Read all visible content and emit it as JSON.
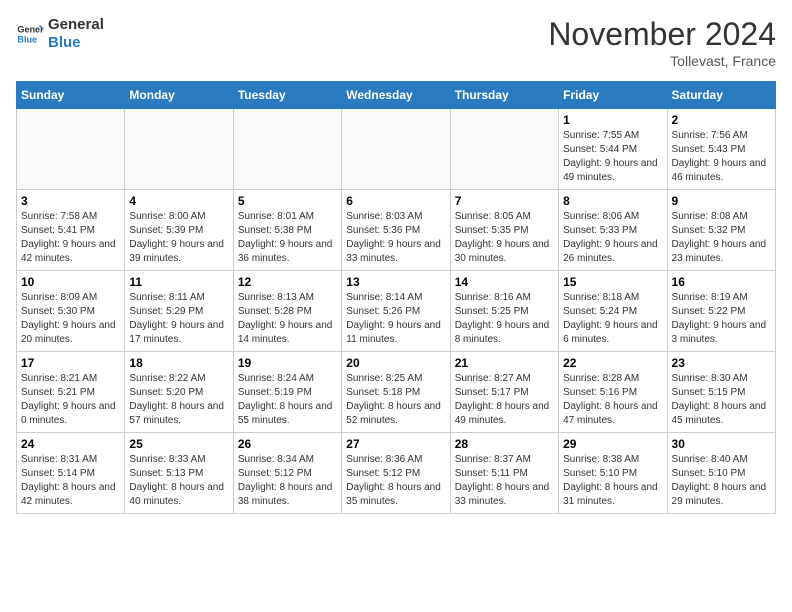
{
  "logo": {
    "line1": "General",
    "line2": "Blue"
  },
  "title": "November 2024",
  "location": "Tollevast, France",
  "weekdays": [
    "Sunday",
    "Monday",
    "Tuesday",
    "Wednesday",
    "Thursday",
    "Friday",
    "Saturday"
  ],
  "weeks": [
    [
      {
        "day": "",
        "info": ""
      },
      {
        "day": "",
        "info": ""
      },
      {
        "day": "",
        "info": ""
      },
      {
        "day": "",
        "info": ""
      },
      {
        "day": "",
        "info": ""
      },
      {
        "day": "1",
        "info": "Sunrise: 7:55 AM\nSunset: 5:44 PM\nDaylight: 9 hours and 49 minutes."
      },
      {
        "day": "2",
        "info": "Sunrise: 7:56 AM\nSunset: 5:43 PM\nDaylight: 9 hours and 46 minutes."
      }
    ],
    [
      {
        "day": "3",
        "info": "Sunrise: 7:58 AM\nSunset: 5:41 PM\nDaylight: 9 hours and 42 minutes."
      },
      {
        "day": "4",
        "info": "Sunrise: 8:00 AM\nSunset: 5:39 PM\nDaylight: 9 hours and 39 minutes."
      },
      {
        "day": "5",
        "info": "Sunrise: 8:01 AM\nSunset: 5:38 PM\nDaylight: 9 hours and 36 minutes."
      },
      {
        "day": "6",
        "info": "Sunrise: 8:03 AM\nSunset: 5:36 PM\nDaylight: 9 hours and 33 minutes."
      },
      {
        "day": "7",
        "info": "Sunrise: 8:05 AM\nSunset: 5:35 PM\nDaylight: 9 hours and 30 minutes."
      },
      {
        "day": "8",
        "info": "Sunrise: 8:06 AM\nSunset: 5:33 PM\nDaylight: 9 hours and 26 minutes."
      },
      {
        "day": "9",
        "info": "Sunrise: 8:08 AM\nSunset: 5:32 PM\nDaylight: 9 hours and 23 minutes."
      }
    ],
    [
      {
        "day": "10",
        "info": "Sunrise: 8:09 AM\nSunset: 5:30 PM\nDaylight: 9 hours and 20 minutes."
      },
      {
        "day": "11",
        "info": "Sunrise: 8:11 AM\nSunset: 5:29 PM\nDaylight: 9 hours and 17 minutes."
      },
      {
        "day": "12",
        "info": "Sunrise: 8:13 AM\nSunset: 5:28 PM\nDaylight: 9 hours and 14 minutes."
      },
      {
        "day": "13",
        "info": "Sunrise: 8:14 AM\nSunset: 5:26 PM\nDaylight: 9 hours and 11 minutes."
      },
      {
        "day": "14",
        "info": "Sunrise: 8:16 AM\nSunset: 5:25 PM\nDaylight: 9 hours and 8 minutes."
      },
      {
        "day": "15",
        "info": "Sunrise: 8:18 AM\nSunset: 5:24 PM\nDaylight: 9 hours and 6 minutes."
      },
      {
        "day": "16",
        "info": "Sunrise: 8:19 AM\nSunset: 5:22 PM\nDaylight: 9 hours and 3 minutes."
      }
    ],
    [
      {
        "day": "17",
        "info": "Sunrise: 8:21 AM\nSunset: 5:21 PM\nDaylight: 9 hours and 0 minutes."
      },
      {
        "day": "18",
        "info": "Sunrise: 8:22 AM\nSunset: 5:20 PM\nDaylight: 8 hours and 57 minutes."
      },
      {
        "day": "19",
        "info": "Sunrise: 8:24 AM\nSunset: 5:19 PM\nDaylight: 8 hours and 55 minutes."
      },
      {
        "day": "20",
        "info": "Sunrise: 8:25 AM\nSunset: 5:18 PM\nDaylight: 8 hours and 52 minutes."
      },
      {
        "day": "21",
        "info": "Sunrise: 8:27 AM\nSunset: 5:17 PM\nDaylight: 8 hours and 49 minutes."
      },
      {
        "day": "22",
        "info": "Sunrise: 8:28 AM\nSunset: 5:16 PM\nDaylight: 8 hours and 47 minutes."
      },
      {
        "day": "23",
        "info": "Sunrise: 8:30 AM\nSunset: 5:15 PM\nDaylight: 8 hours and 45 minutes."
      }
    ],
    [
      {
        "day": "24",
        "info": "Sunrise: 8:31 AM\nSunset: 5:14 PM\nDaylight: 8 hours and 42 minutes."
      },
      {
        "day": "25",
        "info": "Sunrise: 8:33 AM\nSunset: 5:13 PM\nDaylight: 8 hours and 40 minutes."
      },
      {
        "day": "26",
        "info": "Sunrise: 8:34 AM\nSunset: 5:12 PM\nDaylight: 8 hours and 38 minutes."
      },
      {
        "day": "27",
        "info": "Sunrise: 8:36 AM\nSunset: 5:12 PM\nDaylight: 8 hours and 35 minutes."
      },
      {
        "day": "28",
        "info": "Sunrise: 8:37 AM\nSunset: 5:11 PM\nDaylight: 8 hours and 33 minutes."
      },
      {
        "day": "29",
        "info": "Sunrise: 8:38 AM\nSunset: 5:10 PM\nDaylight: 8 hours and 31 minutes."
      },
      {
        "day": "30",
        "info": "Sunrise: 8:40 AM\nSunset: 5:10 PM\nDaylight: 8 hours and 29 minutes."
      }
    ]
  ]
}
